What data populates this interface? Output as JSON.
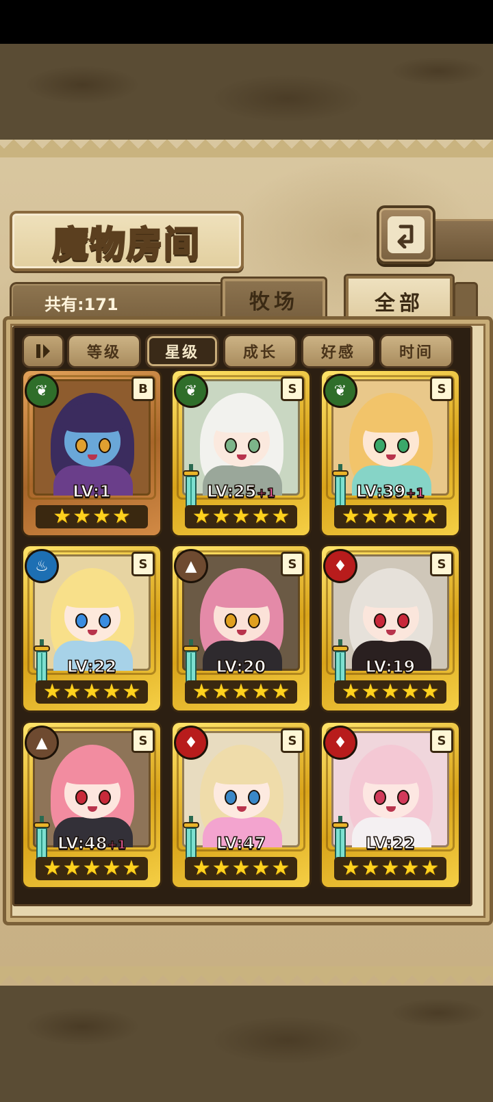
{
  "title": "魔物房间",
  "count_label": "共有:171",
  "tabs": {
    "pasture": "牧场",
    "all": "全部"
  },
  "sort_buttons": [
    "等级",
    "星级",
    "成长",
    "好感",
    "时间"
  ],
  "active_sort": "星级",
  "cards": [
    {
      "element": "wood-icon",
      "grade": "B",
      "level": "LV:1",
      "plus": "",
      "stars": 4,
      "frame": "bronze",
      "hair": "#3b2c5e",
      "skin": "#6aa7d8",
      "eyes": "#e0a030",
      "outfit": "#6a3e8a",
      "bg": "#8e5c2e"
    },
    {
      "element": "wood-icon",
      "grade": "S",
      "level": "LV:25",
      "plus": "+1",
      "stars": 5,
      "frame": "gold",
      "hair": "#f2f2ee",
      "skin": "#fbe9de",
      "eyes": "#7cb58a",
      "outfit": "#9aa79a",
      "bg": "#c9d7c2"
    },
    {
      "element": "wood-icon",
      "grade": "S",
      "level": "LV:39",
      "plus": "+1",
      "stars": 5,
      "frame": "gold",
      "hair": "#f2c46a",
      "skin": "#fde7d4",
      "eyes": "#3aa86a",
      "outfit": "#86d4c7",
      "bg": "#e9c88a"
    },
    {
      "element": "water-icon",
      "grade": "S",
      "level": "LV:22",
      "plus": "",
      "stars": 5,
      "frame": "gold",
      "hair": "#f8e08a",
      "skin": "#fde9dc",
      "eyes": "#3a8de0",
      "outfit": "#a7d2e8",
      "bg": "#e7d4a2"
    },
    {
      "element": "earth-icon",
      "grade": "S",
      "level": "LV:20",
      "plus": "",
      "stars": 5,
      "frame": "gold",
      "hair": "#e48aa8",
      "skin": "#fbe2d8",
      "eyes": "#e0a020",
      "outfit": "#2e2a2e",
      "bg": "#6b5a45"
    },
    {
      "element": "fire-icon",
      "grade": "S",
      "level": "LV:19",
      "plus": "",
      "stars": 5,
      "frame": "gold",
      "hair": "#e6e1da",
      "skin": "#fbe6dc",
      "eyes": "#c8283a",
      "outfit": "#2a2020",
      "bg": "#cfc7b9"
    },
    {
      "element": "earth-icon",
      "grade": "S",
      "level": "LV:48",
      "plus": "+1",
      "stars": 5,
      "frame": "gold",
      "hair": "#f28ca0",
      "skin": "#fde6de",
      "eyes": "#c82a3a",
      "outfit": "#333038",
      "bg": "#8e7458"
    },
    {
      "element": "fire-icon",
      "grade": "S",
      "level": "LV:47",
      "plus": "",
      "stars": 5,
      "frame": "gold",
      "hair": "#efdcaa",
      "skin": "#fdeae0",
      "eyes": "#3a88c8",
      "outfit": "#f3a4cf",
      "bg": "#e8dcc0"
    },
    {
      "element": "fire-icon",
      "grade": "S",
      "level": "LV:22",
      "plus": "",
      "stars": 5,
      "frame": "gold",
      "hair": "#f4c8d4",
      "skin": "#fde7e2",
      "eyes": "#d23a5a",
      "outfit": "#f4f0f2",
      "bg": "#f0d6dc"
    }
  ]
}
